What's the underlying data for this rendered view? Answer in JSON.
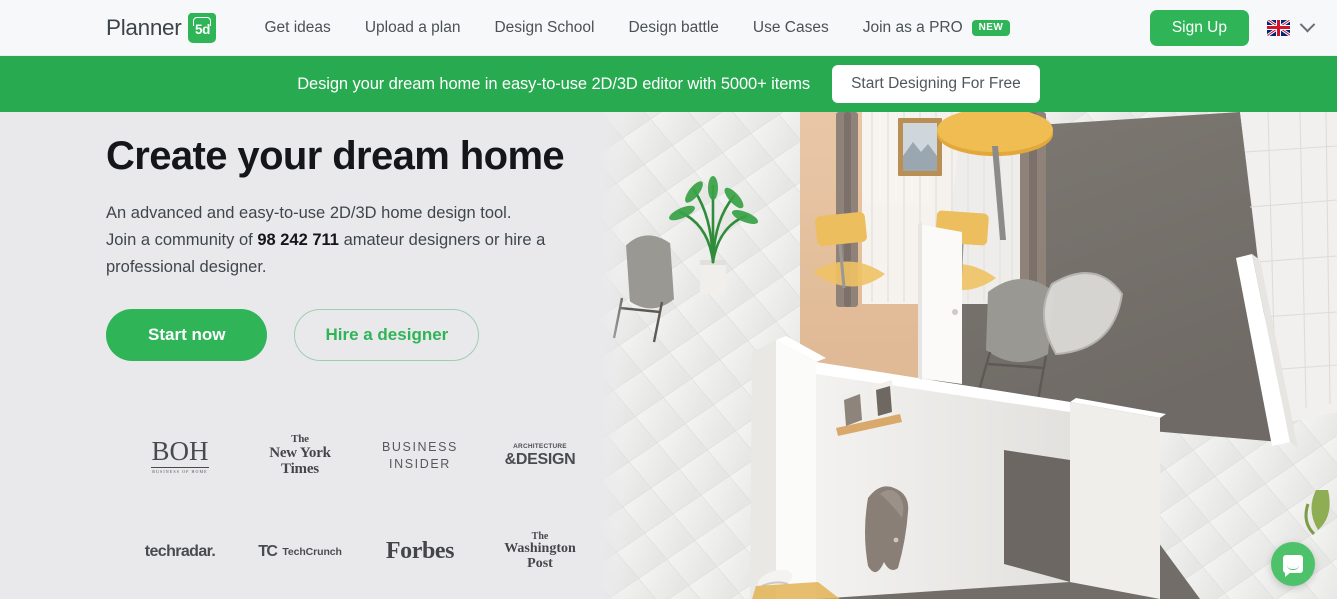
{
  "nav": {
    "brand": {
      "word": "Planner",
      "badge": "5d",
      "badge_icon": "house-icon"
    },
    "links": [
      {
        "label": "Get ideas"
      },
      {
        "label": "Upload a plan"
      },
      {
        "label": "Design School"
      },
      {
        "label": "Design battle"
      },
      {
        "label": "Use Cases"
      }
    ],
    "pro": {
      "label": "Join as a PRO",
      "badge": "NEW"
    },
    "signup_label": "Sign Up",
    "language": {
      "flag": "uk-flag-icon",
      "chevron": "chevron-down-icon"
    }
  },
  "promo": {
    "text": "Design your dream home in easy-to-use 2D/3D editor with 5000+ items",
    "button_label": "Start Designing For Free",
    "background": "#28ab50"
  },
  "hero": {
    "title": "Create your dream home",
    "sub_line1": "An advanced and easy-to-use 2D/3D home design tool.",
    "sub_line2_pre": "Join a community of ",
    "sub_count": "98 242 711",
    "sub_line2_post": " amateur designers or hire a professional designer.",
    "primary_cta": "Start now",
    "secondary_cta": "Hire a designer",
    "accent": "#2fb457",
    "background": "#e9e9ec"
  },
  "press": {
    "logos": [
      {
        "name": "boh",
        "main": "BOH",
        "sub": "BUSINESS OF HOME"
      },
      {
        "name": "new-york-times",
        "line1": "The",
        "line2": "New York",
        "line3": "Times"
      },
      {
        "name": "business-insider",
        "line1": "BUSINESS",
        "line2": "INSIDER"
      },
      {
        "name": "architecture-and-design",
        "line1": "ARCHITECTURE",
        "line2": "&DESIGN"
      },
      {
        "name": "techradar",
        "text": "techradar."
      },
      {
        "name": "techcrunch",
        "mark": "TC",
        "word": "TechCrunch"
      },
      {
        "name": "forbes",
        "text": "Forbes"
      },
      {
        "name": "washington-post",
        "line1": "The",
        "line2": "Washington",
        "line3": "Post"
      }
    ]
  },
  "chat": {
    "icon": "chat-bubble-icon",
    "color": "#4ec26a"
  }
}
